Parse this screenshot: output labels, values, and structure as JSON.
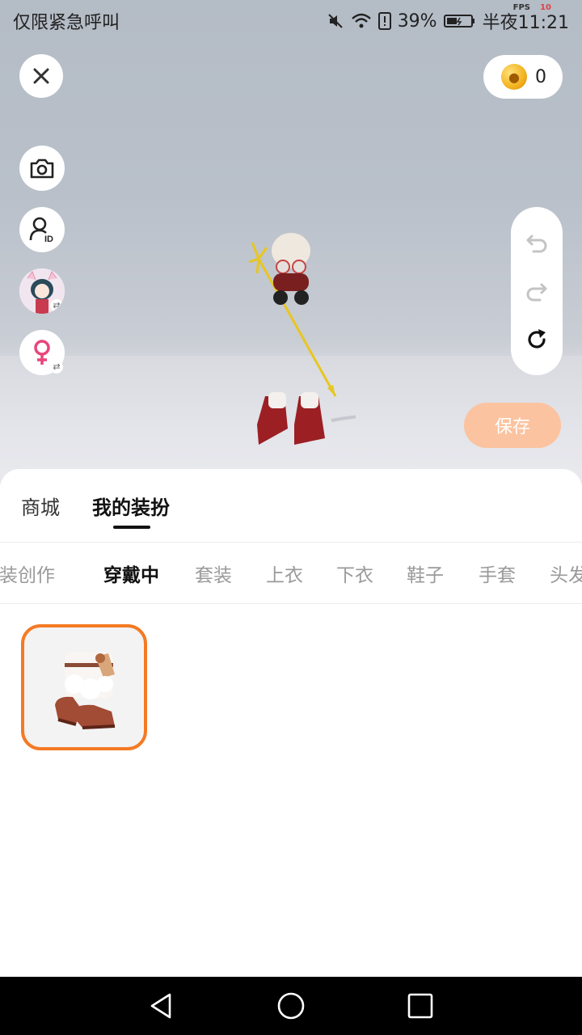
{
  "status_bar": {
    "carrier": "仅限紧急呼叫",
    "battery": "39%",
    "time": "半夜11:21",
    "fps_label": "FPS",
    "fps_value": "10"
  },
  "coins": {
    "count": "0"
  },
  "save_label": "保存",
  "top_tabs": [
    {
      "label": "商城",
      "active": false
    },
    {
      "label": "我的装扮",
      "active": true
    }
  ],
  "categories": [
    {
      "label": "服装创作",
      "active": false
    },
    {
      "label": "穿戴中",
      "active": true
    },
    {
      "label": "套装",
      "active": false
    },
    {
      "label": "上衣",
      "active": false
    },
    {
      "label": "下衣",
      "active": false
    },
    {
      "label": "鞋子",
      "active": false
    },
    {
      "label": "手套",
      "active": false
    },
    {
      "label": "头发",
      "active": false
    }
  ],
  "side_buttons": [
    "camera-icon",
    "user-id-icon",
    "avatar-switch",
    "female-gender-icon"
  ],
  "colors": {
    "accent": "#f47a24",
    "save_button": "#fbc39f"
  }
}
